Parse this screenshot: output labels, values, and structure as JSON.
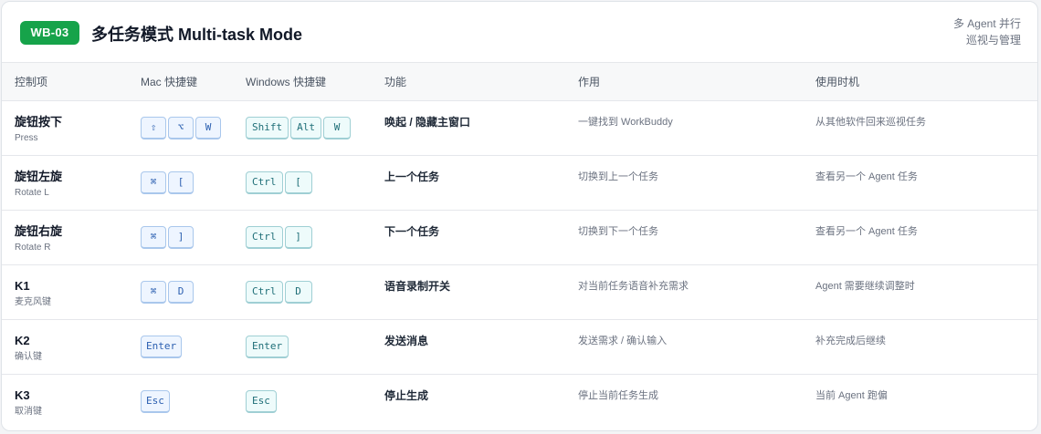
{
  "header": {
    "badge": "WB-03",
    "title": "多任务模式 Multi-task Mode",
    "subtitle_line1": "多 Agent 并行",
    "subtitle_line2": "巡视与管理"
  },
  "columns": [
    "控制项",
    "Mac 快捷键",
    "Windows 快捷键",
    "功能",
    "作用",
    "使用时机"
  ],
  "rows": [
    {
      "control": "旋钮按下",
      "control_sub": "Press",
      "mac_keys": [
        "⇧",
        "⌥",
        "W"
      ],
      "win_keys": [
        "Shift",
        "Alt",
        "W"
      ],
      "function": "唤起 / 隐藏主窗口",
      "effect": "一键找到 WorkBuddy",
      "when": "从其他软件回来巡视任务"
    },
    {
      "control": "旋钮左旋",
      "control_sub": "Rotate L",
      "mac_keys": [
        "⌘",
        "["
      ],
      "win_keys": [
        "Ctrl",
        "["
      ],
      "function": "上一个任务",
      "effect": "切换到上一个任务",
      "when": "查看另一个 Agent 任务"
    },
    {
      "control": "旋钮右旋",
      "control_sub": "Rotate R",
      "mac_keys": [
        "⌘",
        "]"
      ],
      "win_keys": [
        "Ctrl",
        "]"
      ],
      "function": "下一个任务",
      "effect": "切换到下一个任务",
      "when": "查看另一个 Agent 任务"
    },
    {
      "control": "K1",
      "control_sub": "麦克风键",
      "mac_keys": [
        "⌘",
        "D"
      ],
      "win_keys": [
        "Ctrl",
        "D"
      ],
      "function": "语音录制开关",
      "effect": "对当前任务语音补充需求",
      "when": "Agent 需要继续调整时"
    },
    {
      "control": "K2",
      "control_sub": "确认键",
      "mac_keys": [
        "Enter"
      ],
      "win_keys": [
        "Enter"
      ],
      "function": "发送消息",
      "effect": "发送需求 / 确认输入",
      "when": "补充完成后继续"
    },
    {
      "control": "K3",
      "control_sub": "取消键",
      "mac_keys": [
        "Esc"
      ],
      "win_keys": [
        "Esc"
      ],
      "function": "停止生成",
      "effect": "停止当前任务生成",
      "when": "当前 Agent 跑偏"
    }
  ],
  "colors": {
    "badge": "#16a34a",
    "mac_key_bg": "#eef5ff",
    "mac_key_border": "#a9c7ec",
    "win_key_bg": "#eefbfb",
    "win_key_border": "#9fcfd4"
  }
}
